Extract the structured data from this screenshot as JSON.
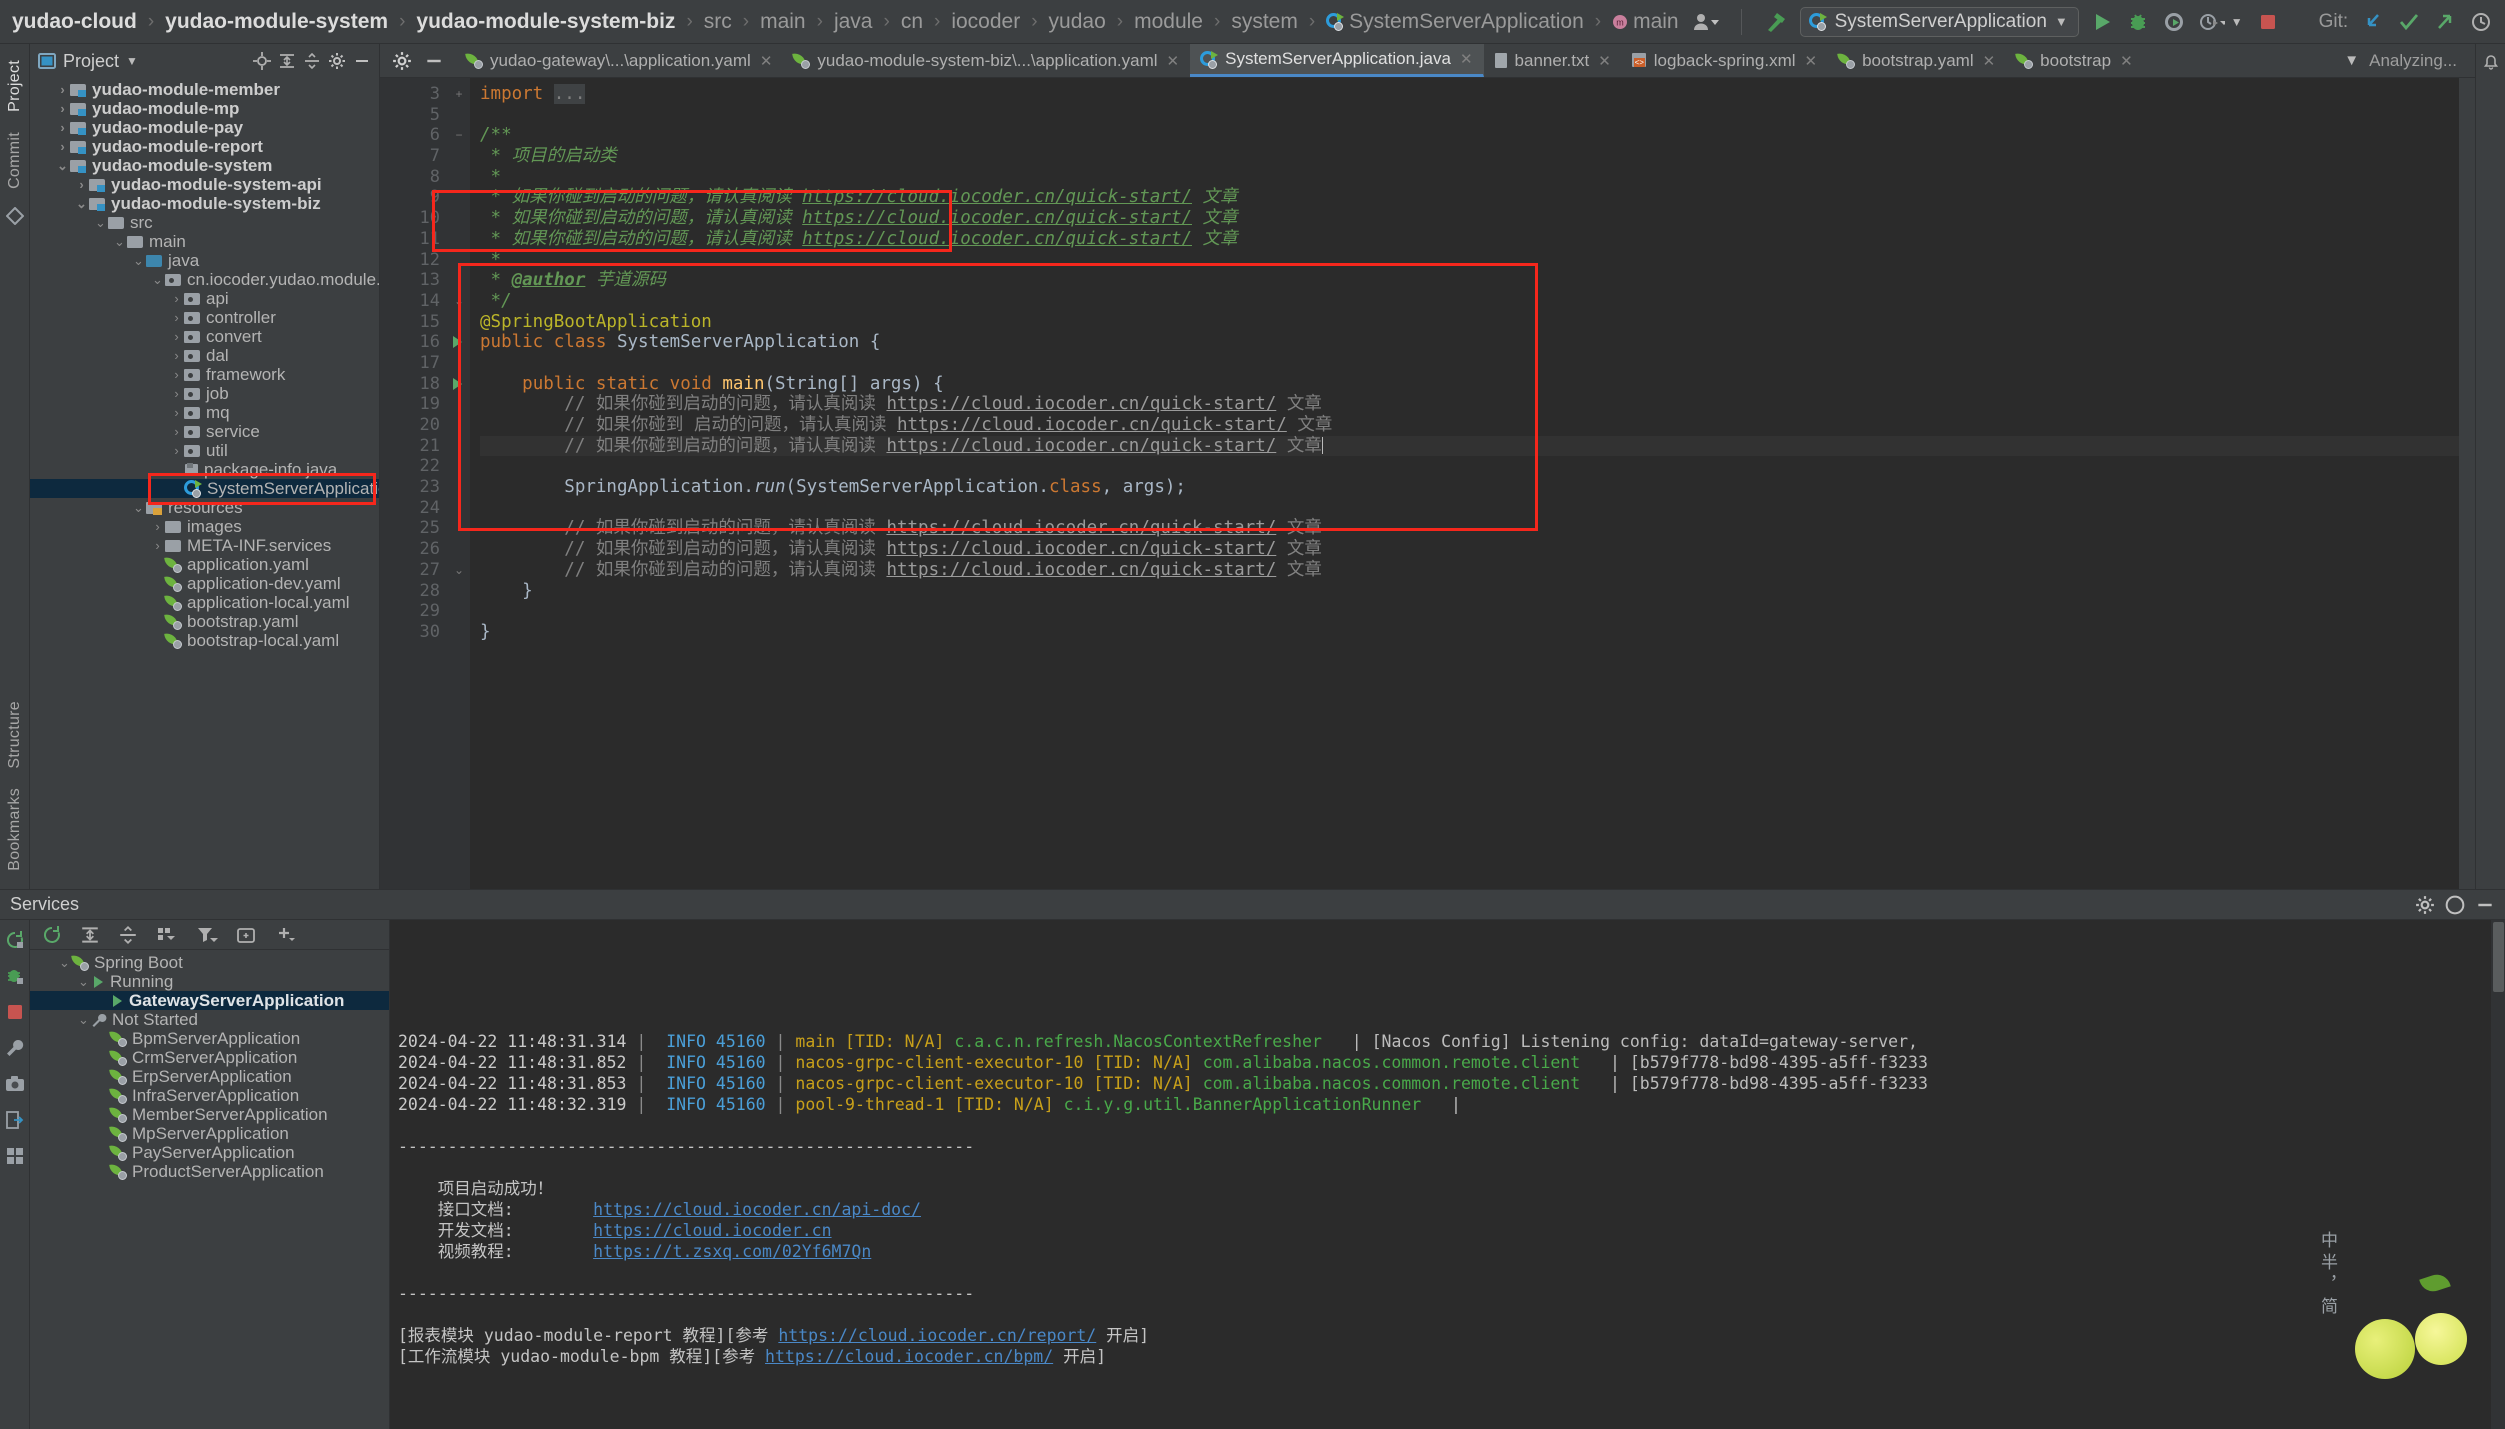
{
  "toolbar": {
    "breadcrumbs": [
      {
        "label": "yudao-cloud",
        "bold": true,
        "icon": ""
      },
      {
        "label": "yudao-module-system",
        "bold": true,
        "icon": ""
      },
      {
        "label": "yudao-module-system-biz",
        "bold": true,
        "icon": ""
      },
      {
        "label": "src",
        "bold": false,
        "icon": ""
      },
      {
        "label": "main",
        "bold": false,
        "icon": ""
      },
      {
        "label": "java",
        "bold": false,
        "icon": ""
      },
      {
        "label": "cn",
        "bold": false,
        "icon": ""
      },
      {
        "label": "iocoder",
        "bold": false,
        "icon": ""
      },
      {
        "label": "yudao",
        "bold": false,
        "icon": ""
      },
      {
        "label": "module",
        "bold": false,
        "icon": ""
      },
      {
        "label": "system",
        "bold": false,
        "icon": ""
      },
      {
        "label": "SystemServerApplication",
        "bold": false,
        "icon": "springboot-icon"
      },
      {
        "label": "main",
        "bold": false,
        "icon": "method-icon"
      }
    ],
    "run_config": "SystemServerApplication",
    "git_label": "Git:",
    "separator": "›"
  },
  "left_strip": {
    "tabs": [
      "Project",
      "Commit"
    ],
    "bottom_tabs": [
      "Structure",
      "Bookmarks"
    ]
  },
  "project": {
    "title": "Project",
    "tree": [
      {
        "depth": 1,
        "label": "yudao-module-member",
        "chev": "›",
        "icon": "module-icon",
        "bold": true
      },
      {
        "depth": 1,
        "label": "yudao-module-mp",
        "chev": "›",
        "icon": "module-icon",
        "bold": true
      },
      {
        "depth": 1,
        "label": "yudao-module-pay",
        "chev": "›",
        "icon": "module-icon",
        "bold": true
      },
      {
        "depth": 1,
        "label": "yudao-module-report",
        "chev": "›",
        "icon": "module-icon",
        "bold": true
      },
      {
        "depth": 1,
        "label": "yudao-module-system",
        "chev": "⌄",
        "icon": "module-icon",
        "bold": true
      },
      {
        "depth": 2,
        "label": "yudao-module-system-api",
        "chev": "›",
        "icon": "module-icon",
        "bold": true
      },
      {
        "depth": 2,
        "label": "yudao-module-system-biz",
        "chev": "⌄",
        "icon": "module-icon",
        "bold": true
      },
      {
        "depth": 3,
        "label": "src",
        "chev": "⌄",
        "icon": "folder-icon",
        "bold": false
      },
      {
        "depth": 4,
        "label": "main",
        "chev": "⌄",
        "icon": "folder-icon",
        "bold": false
      },
      {
        "depth": 5,
        "label": "java",
        "chev": "⌄",
        "icon": "source-folder-icon",
        "bold": false
      },
      {
        "depth": 6,
        "label": "cn.iocoder.yudao.module.system",
        "chev": "⌄",
        "icon": "package-icon",
        "bold": false
      },
      {
        "depth": 7,
        "label": "api",
        "chev": "›",
        "icon": "package-icon",
        "bold": false
      },
      {
        "depth": 7,
        "label": "controller",
        "chev": "›",
        "icon": "package-icon",
        "bold": false
      },
      {
        "depth": 7,
        "label": "convert",
        "chev": "›",
        "icon": "package-icon",
        "bold": false
      },
      {
        "depth": 7,
        "label": "dal",
        "chev": "›",
        "icon": "package-icon",
        "bold": false
      },
      {
        "depth": 7,
        "label": "framework",
        "chev": "›",
        "icon": "package-icon",
        "bold": false
      },
      {
        "depth": 7,
        "label": "job",
        "chev": "›",
        "icon": "package-icon",
        "bold": false
      },
      {
        "depth": 7,
        "label": "mq",
        "chev": "›",
        "icon": "package-icon",
        "bold": false
      },
      {
        "depth": 7,
        "label": "service",
        "chev": "›",
        "icon": "package-icon",
        "bold": false
      },
      {
        "depth": 7,
        "label": "util",
        "chev": "›",
        "icon": "package-icon",
        "bold": false
      },
      {
        "depth": 7,
        "label": "package-info.java",
        "chev": "",
        "icon": "java-file-icon",
        "bold": false
      },
      {
        "depth": 7,
        "label": "SystemServerApplication",
        "chev": "",
        "icon": "springboot-icon",
        "bold": false,
        "selected": true
      },
      {
        "depth": 5,
        "label": "resources",
        "chev": "⌄",
        "icon": "resource-folder-icon",
        "bold": false
      },
      {
        "depth": 6,
        "label": "images",
        "chev": "›",
        "icon": "folder-icon",
        "bold": false
      },
      {
        "depth": 6,
        "label": "META-INF.services",
        "chev": "›",
        "icon": "folder-icon",
        "bold": false
      },
      {
        "depth": 6,
        "label": "application.yaml",
        "chev": "",
        "icon": "spring-yaml-icon",
        "bold": false
      },
      {
        "depth": 6,
        "label": "application-dev.yaml",
        "chev": "",
        "icon": "spring-yaml-icon",
        "bold": false
      },
      {
        "depth": 6,
        "label": "application-local.yaml",
        "chev": "",
        "icon": "spring-yaml-icon",
        "bold": false
      },
      {
        "depth": 6,
        "label": "bootstrap.yaml",
        "chev": "",
        "icon": "spring-yaml-icon",
        "bold": false
      },
      {
        "depth": 6,
        "label": "bootstrap-local.yaml",
        "chev": "",
        "icon": "spring-yaml-icon",
        "bold": false
      }
    ]
  },
  "editor": {
    "tabs": [
      {
        "label": "yudao-gateway\\...\\application.yaml",
        "icon": "spring-yaml-icon",
        "active": false
      },
      {
        "label": "yudao-module-system-biz\\...\\application.yaml",
        "icon": "spring-yaml-icon",
        "active": false
      },
      {
        "label": "SystemServerApplication.java",
        "icon": "springboot-icon",
        "active": true
      },
      {
        "label": "banner.txt",
        "icon": "text-file-icon",
        "active": false
      },
      {
        "label": "logback-spring.xml",
        "icon": "xml-file-icon",
        "active": false
      },
      {
        "label": "bootstrap.yaml",
        "icon": "spring-yaml-icon",
        "active": false
      },
      {
        "label": "bootstrap",
        "icon": "spring-yaml-icon",
        "active": false
      }
    ],
    "status_right": "Analyzing...",
    "line_numbers": [
      "3",
      "5",
      "6",
      "7",
      "8",
      "9",
      "10",
      "11",
      "12",
      "13",
      "14",
      "15",
      "16",
      "17",
      "18",
      "19",
      "20",
      "21",
      "22",
      "23",
      "24",
      "25",
      "26",
      "27",
      "28",
      "29",
      "30"
    ],
    "lines": [
      {
        "n": "3",
        "html": "<span class=\"kw\">import</span> <span class=\"cmt2\" style=\"background:#3f4244\">...</span>"
      },
      {
        "n": "5",
        "html": ""
      },
      {
        "n": "6",
        "html": "<span class=\"cmt\">/**</span>"
      },
      {
        "n": "7",
        "html": "<span class=\"cmt\"> * 项目的启动类</span>"
      },
      {
        "n": "8",
        "html": "<span class=\"cmt\"> *</span>"
      },
      {
        "n": "9",
        "html": "<span class=\"cmt\"> * 如果你碰到启动的问题，请认真阅读 </span><span class=\"lnk\">https://cloud.iocoder.cn/quick-start/</span><span class=\"cmt\"> 文章</span>"
      },
      {
        "n": "10",
        "html": "<span class=\"cmt\"> * 如果你碰到启动的问题，请认真阅读 </span><span class=\"lnk\">https://cloud.iocoder.cn/quick-start/</span><span class=\"cmt\"> 文章</span>"
      },
      {
        "n": "11",
        "html": "<span class=\"cmt\"> * 如果你碰到启动的问题，请认真阅读 </span><span class=\"lnk\">https://cloud.iocoder.cn/quick-start/</span><span class=\"cmt\"> 文章</span>"
      },
      {
        "n": "12",
        "html": "<span class=\"cmt\"> *</span>"
      },
      {
        "n": "13",
        "html": "<span class=\"cmt\"> * </span><span class=\"tagdoc\">@author</span><span class=\"cmt\"> 芋道源码</span>"
      },
      {
        "n": "14",
        "html": "<span class=\"cmt\"> */</span>"
      },
      {
        "n": "15",
        "html": "<span class=\"ann\">@SpringBootApplication</span>"
      },
      {
        "n": "16",
        "html": "<span class=\"kw\">public class </span><span class=\"cls\">SystemServerApplication </span>{"
      },
      {
        "n": "17",
        "html": ""
      },
      {
        "n": "18",
        "html": "    <span class=\"kw\">public static void </span><span class=\"fn\">main</span>(String[] args) {"
      },
      {
        "n": "19",
        "html": "        <span class=\"cmt2\">// 如果你碰到启动的问题，请认真阅读 </span><span class=\"lnk2\">https://cloud.iocoder.cn/quick-start/</span><span class=\"cmt2\"> 文章</span>"
      },
      {
        "n": "20",
        "html": "        <span class=\"cmt2\">// 如果你碰到 启动的问题，请认真阅读 </span><span class=\"lnk2\">https://cloud.iocoder.cn/quick-start/</span><span class=\"cmt2\"> 文章</span>"
      },
      {
        "n": "21",
        "html": "        <span class=\"cmt2\">// 如果你碰到启动的问题，请认真阅读 </span><span class=\"lnk2\">https://cloud.iocoder.cn/quick-start/</span><span class=\"cmt2\"> 文章</span><span class=\"caret\"></span>",
        "hl": true
      },
      {
        "n": "22",
        "html": ""
      },
      {
        "n": "23",
        "html": "        SpringApplication.<span style=\"font-style:italic\">run</span>(SystemServerApplication.<span class=\"kw\">class</span>, args);"
      },
      {
        "n": "24",
        "html": ""
      },
      {
        "n": "25",
        "html": "        <span class=\"cmt2\">// 如果你碰到启动的问题，请认真阅读 </span><span class=\"lnk2\">https://cloud.iocoder.cn/quick-start/</span><span class=\"cmt2\"> 文章</span>"
      },
      {
        "n": "26",
        "html": "        <span class=\"cmt2\">// 如果你碰到启动的问题，请认真阅读 </span><span class=\"lnk2\">https://cloud.iocoder.cn/quick-start/</span><span class=\"cmt2\"> 文章</span>"
      },
      {
        "n": "27",
        "html": "        <span class=\"cmt2\">// 如果你碰到启动的问题，请认真阅读 </span><span class=\"lnk2\">https://cloud.iocoder.cn/quick-start/</span><span class=\"cmt2\"> 文章</span>"
      },
      {
        "n": "28",
        "html": "    }"
      },
      {
        "n": "29",
        "html": ""
      },
      {
        "n": "30",
        "html": "}"
      }
    ]
  },
  "services": {
    "title": "Services",
    "tree": [
      {
        "depth": 1,
        "label": "Spring Boot",
        "chev": "⌄",
        "icon": "spring-icon",
        "selected": false
      },
      {
        "depth": 2,
        "label": "Running",
        "chev": "⌄",
        "icon": "run-icon",
        "selected": false
      },
      {
        "depth": 3,
        "label": "GatewayServerApplication",
        "chev": "",
        "icon": "run-icon",
        "selected": true
      },
      {
        "depth": 2,
        "label": "Not Started",
        "chev": "⌄",
        "icon": "wrench-icon",
        "selected": false
      },
      {
        "depth": 3,
        "label": "BpmServerApplication",
        "chev": "",
        "icon": "spring-icon",
        "selected": false
      },
      {
        "depth": 3,
        "label": "CrmServerApplication",
        "chev": "",
        "icon": "spring-icon",
        "selected": false
      },
      {
        "depth": 3,
        "label": "ErpServerApplication",
        "chev": "",
        "icon": "spring-icon",
        "selected": false
      },
      {
        "depth": 3,
        "label": "InfraServerApplication",
        "chev": "",
        "icon": "spring-icon",
        "selected": false
      },
      {
        "depth": 3,
        "label": "MemberServerApplication",
        "chev": "",
        "icon": "spring-icon",
        "selected": false
      },
      {
        "depth": 3,
        "label": "MpServerApplication",
        "chev": "",
        "icon": "spring-icon",
        "selected": false
      },
      {
        "depth": 3,
        "label": "PayServerApplication",
        "chev": "",
        "icon": "spring-icon",
        "selected": false
      },
      {
        "depth": 3,
        "label": "ProductServerApplication",
        "chev": "",
        "icon": "spring-icon",
        "selected": false
      }
    ]
  },
  "console": {
    "log_lines": [
      {
        "ts": "2024-04-22 11:48:31.314",
        "lvl": "INFO 45160",
        "thread": "main [TID: N/A]",
        "cls": "c.a.c.n.refresh.NacosContextRefresher",
        "msg": "| [Nacos Config] Listening config: dataId=gateway-server,"
      },
      {
        "ts": "2024-04-22 11:48:31.852",
        "lvl": "INFO 45160",
        "thread": "nacos-grpc-client-executor-10 [TID: N/A]",
        "cls": "com.alibaba.nacos.common.remote.client",
        "msg": "| [b579f778-bd98-4395-a5ff-f3233"
      },
      {
        "ts": "2024-04-22 11:48:31.853",
        "lvl": "INFO 45160",
        "thread": "nacos-grpc-client-executor-10 [TID: N/A]",
        "cls": "com.alibaba.nacos.common.remote.client",
        "msg": "| [b579f778-bd98-4395-a5ff-f3233"
      },
      {
        "ts": "2024-04-22 11:48:32.319",
        "lvl": "INFO 45160",
        "thread": "pool-9-thread-1 [TID: N/A]",
        "cls": "c.i.y.g.util.BannerApplicationRunner",
        "msg": "|"
      }
    ],
    "banner": {
      "divider": "----------------------------------------------------------",
      "success": "项目启动成功！",
      "rows": [
        {
          "label": "接口文档:",
          "link": "https://cloud.iocoder.cn/api-doc/"
        },
        {
          "label": "开发文档:",
          "link": "https://cloud.iocoder.cn"
        },
        {
          "label": "视频教程:",
          "link": "https://t.zsxq.com/02Yf6M7Qn"
        }
      ],
      "footer_lines": [
        {
          "pre": "[报表模块 yudao-module-report 教程][参考 ",
          "link": "https://cloud.iocoder.cn/report/",
          "post": " 开启]"
        },
        {
          "pre": "[工作流模块 yudao-module-bpm 教程][参考 ",
          "link": "https://cloud.iocoder.cn/bpm/",
          "post": " 开启]"
        }
      ]
    }
  },
  "decoration": {
    "vertical_text": "中半，简"
  }
}
